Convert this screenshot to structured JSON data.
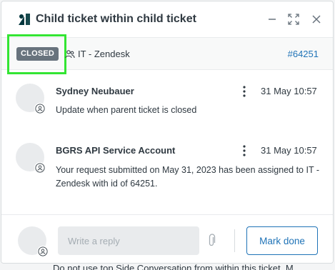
{
  "window": {
    "title": "Child ticket within child ticket"
  },
  "ticket": {
    "status": "CLOSED",
    "group": "IT - Zendesk",
    "number": "#64251"
  },
  "comments": [
    {
      "author": "Sydney Neubauer",
      "time": "31 May 10:57",
      "body": "Update when parent ticket is closed"
    },
    {
      "author": "BGRS API Service Account",
      "time": "31 May 10:57",
      "body": "Your request submitted on May 31, 2023 has been assigned to IT - Zendesk with id of 64251."
    }
  ],
  "footer": {
    "reply_placeholder": "Write a reply",
    "mark_done_label": "Mark done"
  },
  "background": {
    "partial_text": "Do not use top Side Conversation from within this ticket. M"
  },
  "colors": {
    "accent": "#1f73b7",
    "status_badge": "#68737d",
    "highlight": "#33e533",
    "logo": "#03363d"
  },
  "icons": {
    "logo": "zendesk-logo-icon",
    "minimize": "minimize-icon",
    "expand": "expand-icon",
    "close": "close-icon",
    "group": "group-icon",
    "more": "kebab-menu-icon",
    "attach": "paperclip-icon",
    "avatar_badge": "user-badge-icon"
  }
}
